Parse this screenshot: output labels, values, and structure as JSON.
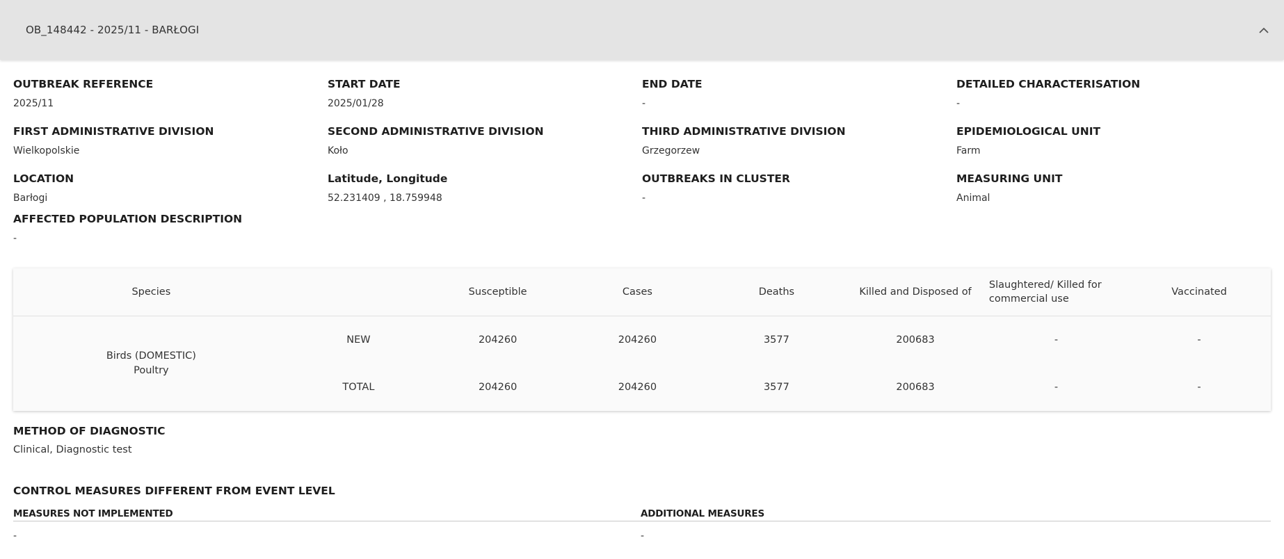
{
  "header": {
    "title": "OB_148442 - 2025/11 - BARŁOGI"
  },
  "fields": {
    "outbreak_reference": {
      "label": "OUTBREAK REFERENCE",
      "value": "2025/11"
    },
    "start_date": {
      "label": "START DATE",
      "value": "2025/01/28"
    },
    "end_date": {
      "label": "END DATE",
      "value": "-"
    },
    "detailed_characterisation": {
      "label": "DETAILED CHARACTERISATION",
      "value": "-"
    },
    "first_admin_division": {
      "label": "FIRST ADMINISTRATIVE DIVISION",
      "value": "Wielkopolskie"
    },
    "second_admin_division": {
      "label": "SECOND ADMINISTRATIVE DIVISION",
      "value": "Koło"
    },
    "third_admin_division": {
      "label": "THIRD ADMINISTRATIVE DIVISION",
      "value": "Grzegorzew"
    },
    "epidemiological_unit": {
      "label": "EPIDEMIOLOGICAL UNIT",
      "value": "Farm"
    },
    "location": {
      "label": "LOCATION",
      "value": "Barłogi"
    },
    "lat_long": {
      "label": "Latitude, Longitude",
      "value": "52.231409 , 18.759948"
    },
    "outbreaks_in_cluster": {
      "label": "OUTBREAKS IN CLUSTER",
      "value": "-"
    },
    "measuring_unit": {
      "label": "MEASURING UNIT",
      "value": "Animal"
    },
    "affected_population": {
      "label": "AFFECTED POPULATION DESCRIPTION",
      "value": "-"
    }
  },
  "table": {
    "headers": {
      "species": "Species",
      "susceptible": "Susceptible",
      "cases": "Cases",
      "deaths": "Deaths",
      "killed": "Killed and Disposed of",
      "slaughtered_line1": "Slaughtered/ Killed for",
      "slaughtered_line2": "commercial use",
      "vaccinated": "Vaccinated"
    },
    "species_line1": "Birds (DOMESTIC)",
    "species_line2": "Poultry",
    "rows": [
      {
        "type": "NEW",
        "susceptible": "204260",
        "cases": "204260",
        "deaths": "3577",
        "killed": "200683",
        "slaughtered": "-",
        "vaccinated": "-"
      },
      {
        "type": "TOTAL",
        "susceptible": "204260",
        "cases": "204260",
        "deaths": "3577",
        "killed": "200683",
        "slaughtered": "-",
        "vaccinated": "-"
      }
    ]
  },
  "diagnostic": {
    "label": "METHOD OF DIAGNOSTIC",
    "value": "Clinical, Diagnostic test"
  },
  "control_measures": {
    "label": "CONTROL MEASURES DIFFERENT FROM EVENT LEVEL",
    "not_implemented_label": "MEASURES NOT IMPLEMENTED",
    "not_implemented_value": "-",
    "additional_label": "ADDITIONAL MEASURES",
    "additional_value": "-"
  },
  "icons": {
    "collapse": "chevron-up-icon"
  }
}
